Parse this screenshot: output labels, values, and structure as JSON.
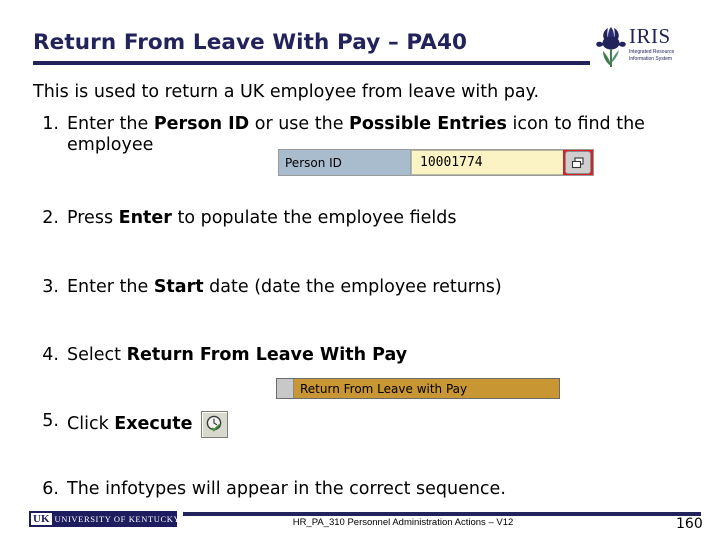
{
  "slide": {
    "title": "Return From Leave With Pay – PA40",
    "lead": "This is used to return a UK employee from leave with pay."
  },
  "logo": {
    "name": "IRIS",
    "tagline_line1": "Integrated Resource",
    "tagline_line2": "Information System",
    "icon": "iris-flower-icon",
    "color": "#23235c",
    "leaf_color": "#3f7d4f"
  },
  "steps": [
    {
      "number": "1.",
      "parts": [
        {
          "text": "Enter the ",
          "bold": false
        },
        {
          "text": "Person ID",
          "bold": true
        },
        {
          "text": " or use the ",
          "bold": false
        },
        {
          "text": "Possible Entries",
          "bold": true
        },
        {
          "text": " icon to find the employee",
          "bold": false
        }
      ]
    },
    {
      "number": "2.",
      "parts": [
        {
          "text": "Press ",
          "bold": false
        },
        {
          "text": "Enter",
          "bold": true
        },
        {
          "text": " to populate the employee fields",
          "bold": false
        }
      ]
    },
    {
      "number": "3.",
      "parts": [
        {
          "text": "Enter the ",
          "bold": false
        },
        {
          "text": "Start",
          "bold": true
        },
        {
          "text": " date (date the employee returns)",
          "bold": false
        }
      ]
    },
    {
      "number": "4.",
      "parts": [
        {
          "text": "Select ",
          "bold": false
        },
        {
          "text": "Return From Leave With Pay",
          "bold": true
        }
      ]
    },
    {
      "number": "5.",
      "parts": [
        {
          "text": "Click ",
          "bold": false
        },
        {
          "text": "Execute",
          "bold": true
        }
      ]
    },
    {
      "number": "6.",
      "parts": [
        {
          "text": "The infotypes will appear in the correct sequence.",
          "bold": false
        }
      ]
    }
  ],
  "person_id_field": {
    "label": "Person ID",
    "value": "10001774",
    "label_bg": "#a9bccd",
    "value_bg": "#fbf3c4",
    "possible_entries_icon": "possible-entries-icon",
    "highlight_color": "#d8202a"
  },
  "action_row": {
    "label": "Return From Leave with Pay",
    "bg": "#c89632"
  },
  "execute_button": {
    "icon": "clock-check-execute-icon"
  },
  "footer": {
    "uk_mark": "UK",
    "uk_words": "UNIVERSITY OF KENTUCKY",
    "course": "HR_PA_310 Personnel Administration Actions – V12",
    "page": "160",
    "rule_color": "#23235c"
  }
}
